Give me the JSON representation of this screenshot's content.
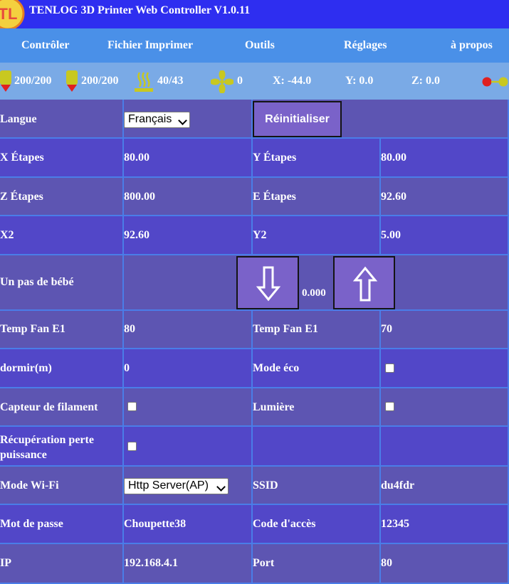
{
  "app": {
    "title": "TENLOG 3D Printer Web Controller V1.0.11",
    "logo_text": "TL"
  },
  "menu": {
    "items": [
      "Contrôler",
      "Fichier Imprimer",
      "Outils",
      "Réglages",
      "à propos"
    ]
  },
  "status": {
    "hotend1": "200/200",
    "hotend2": "200/200",
    "bed": "40/43",
    "fan": "0",
    "x": "X: -44.0",
    "y": "Y: 0.0",
    "z": "Z: 0.0"
  },
  "settings": {
    "language": {
      "label": "Langue",
      "value": "Français"
    },
    "reset_button": "Réinitialiser",
    "x_steps": {
      "label": "X Étapes",
      "value": "80.00"
    },
    "y_steps": {
      "label": "Y Étapes",
      "value": "80.00"
    },
    "z_steps": {
      "label": "Z Étapes",
      "value": "800.00"
    },
    "e_steps": {
      "label": "E Étapes",
      "value": "92.60"
    },
    "x2": {
      "label": "X2",
      "value": "92.60"
    },
    "y2": {
      "label": "Y2",
      "value": "5.00"
    },
    "babystep": {
      "label": "Un pas de bébé",
      "value": "0.000"
    },
    "temp_fan_e1_a": {
      "label": "Temp Fan E1",
      "value": "80"
    },
    "temp_fan_e1_b": {
      "label": "Temp Fan E1",
      "value": "70"
    },
    "sleep": {
      "label": "dormir(m)",
      "value": "0"
    },
    "eco_mode": {
      "label": "Mode éco",
      "checked": false
    },
    "filament_sensor": {
      "label": "Capteur de filament",
      "checked": false
    },
    "light": {
      "label": "Lumière",
      "checked": false
    },
    "power_loss": {
      "label": "Récupération perte puissance",
      "checked": false
    },
    "wifi_mode": {
      "label": "Mode Wi-Fi",
      "value": "Http Server(AP)"
    },
    "ssid": {
      "label": "SSID",
      "value": "du4fdr"
    },
    "password": {
      "label": "Mot de passe",
      "value": "Choupette38"
    },
    "access_code": {
      "label": "Code d'accès",
      "value": "12345"
    },
    "ip": {
      "label": "IP",
      "value": "192.168.4.1"
    },
    "port": {
      "label": "Port",
      "value": "80"
    }
  },
  "colors": {
    "title_bar": "#2e2ef0",
    "menu_bar": "#4a90e8",
    "status_bar": "#7aaae6",
    "cell_a": "#5d55b2",
    "cell_b": "#5247c8",
    "grid_line": "#4a7de8",
    "button": "#7a62c9",
    "icon_yellow": "#c8c820",
    "icon_red": "#e02020"
  },
  "icons": [
    "hotend-icon",
    "bed-icon",
    "fan-icon",
    "connection-status-icon",
    "arrow-down-icon",
    "arrow-up-icon"
  ]
}
